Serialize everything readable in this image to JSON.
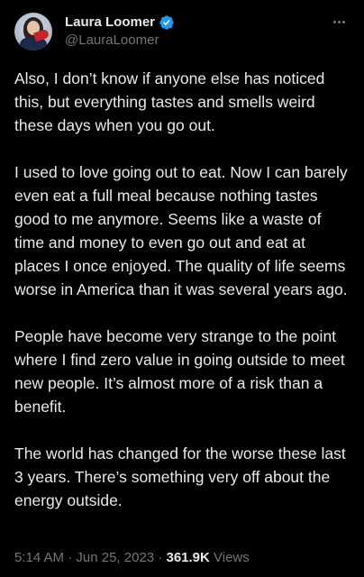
{
  "author": {
    "display_name": "Laura Loomer",
    "handle": "@LauraLoomer",
    "verified": true
  },
  "tweet": {
    "paragraphs": [
      "Also, I don’t know if anyone else has noticed this, but everything tastes and smells weird these days when you go out.",
      "I used to love going out to eat. Now I can barely even eat a full meal because nothing tastes good to me anymore. Seems like a waste of time and money to even go out and eat at places I once enjoyed. The quality of life seems worse in America than it was several years ago.",
      "People have become very strange to the point where I find zero value in going outside to meet new people. It’s almost more of a risk than a benefit.",
      "The world has changed for the worse these last 3 years. There’s something very off about the energy outside."
    ]
  },
  "meta": {
    "time": "5:14 AM",
    "separator": " · ",
    "date": "Jun 25, 2023",
    "views_count": "361.9K",
    "views_label": " Views"
  },
  "icons": {
    "verified": "verified-badge-icon",
    "more": "more-options-icon"
  },
  "colors": {
    "background": "#000000",
    "text_primary": "#e7e9ea",
    "text_secondary": "#71767b",
    "verified_blue": "#1d9bf0"
  }
}
